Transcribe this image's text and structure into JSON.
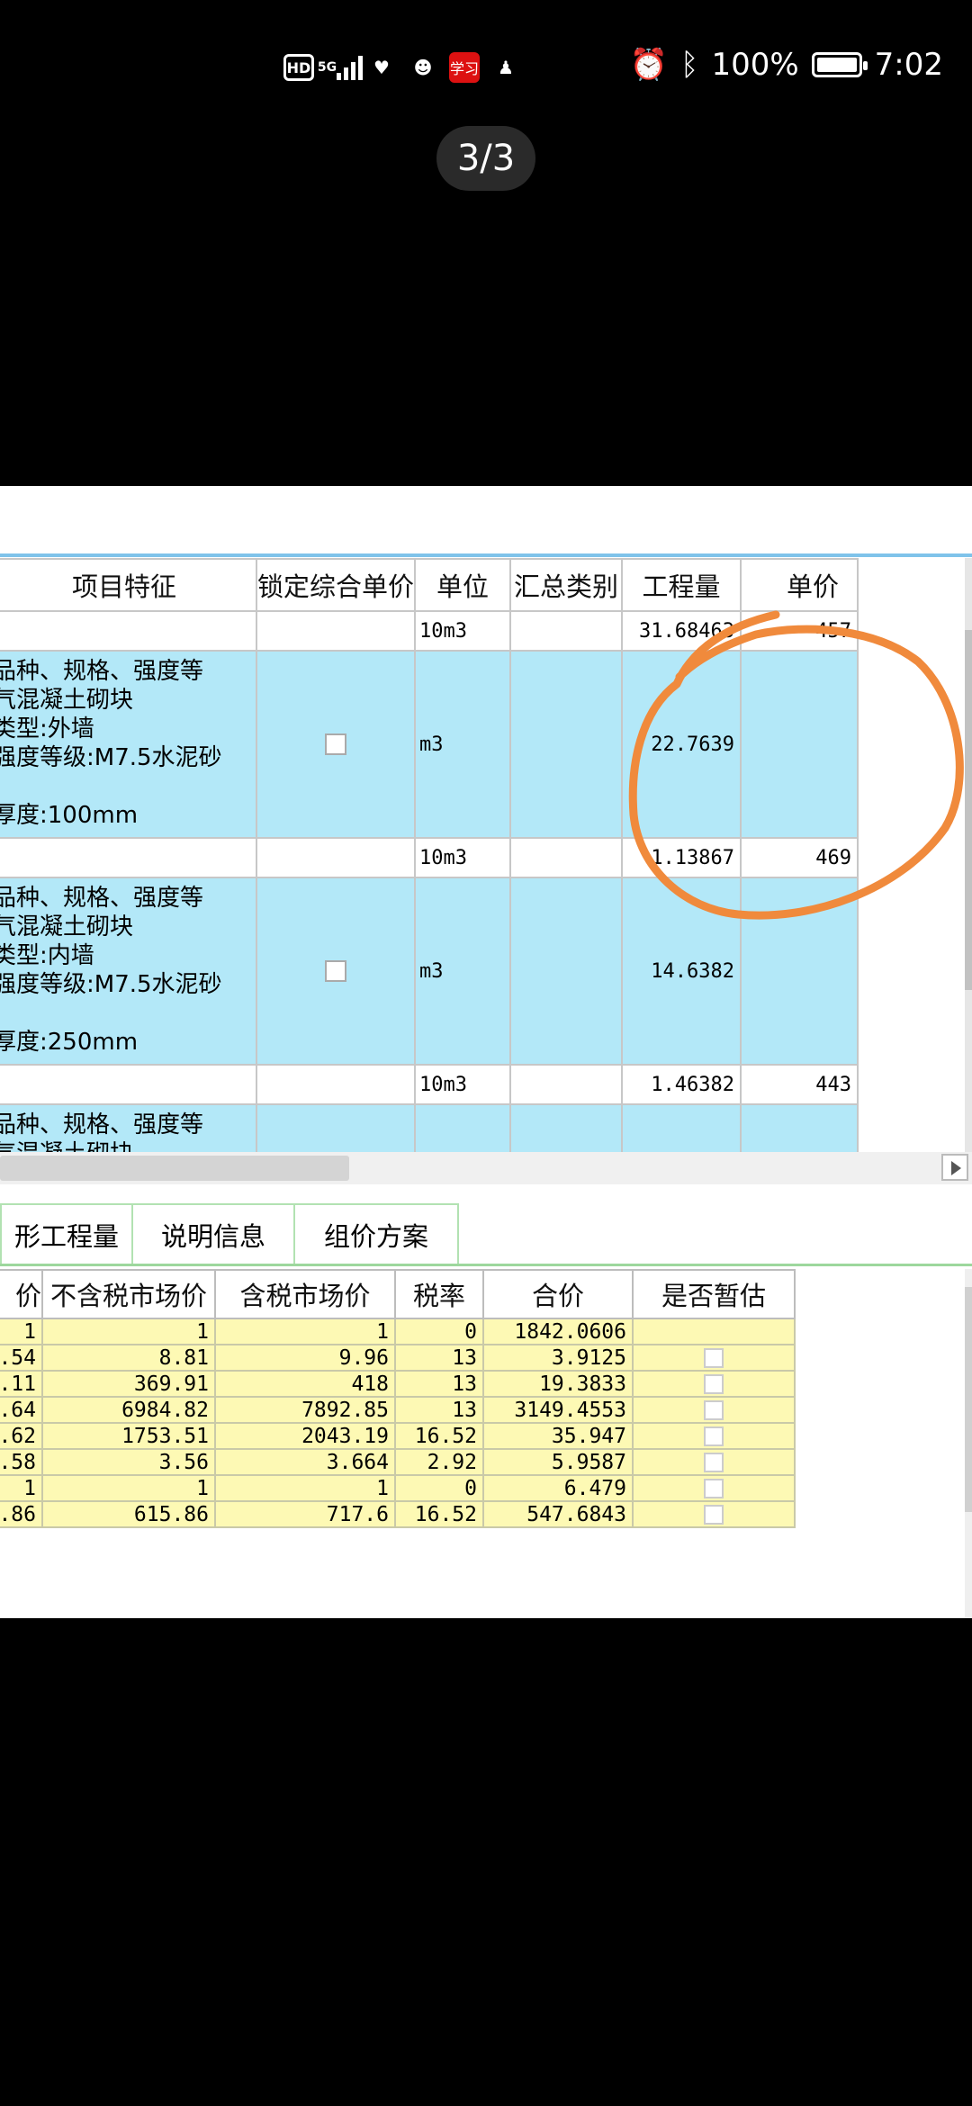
{
  "status_bar": {
    "hd": "HD",
    "network": "5G",
    "battery": "100%",
    "time": "7:02",
    "app_badge": "学习"
  },
  "pager": "3/3",
  "grid1": {
    "headers": [
      "项目特征",
      "锁定综合单价",
      "单位",
      "汇总类别",
      "工程量",
      "单价"
    ],
    "row1": {
      "unit": "10m3",
      "qty": "31.68463",
      "price": "457"
    },
    "item1": {
      "feature_lines": [
        "品种、规格、强度等",
        "气混凝土砌块",
        "类型:外墙",
        "强度等级:M7.5水泥砂",
        "",
        "厚度:100mm"
      ],
      "unit": "m3",
      "qty": "22.7639"
    },
    "row2": {
      "unit": "10m3",
      "qty": "1.13867",
      "price": "469"
    },
    "item2": {
      "feature_lines": [
        "品种、规格、强度等",
        "气混凝土砌块",
        "类型:内墙",
        "强度等级:M7.5水泥砂",
        "",
        "厚度:250mm"
      ],
      "unit": "m3",
      "qty": "14.6382"
    },
    "row3": {
      "unit": "10m3",
      "qty": "1.46382",
      "price": "443"
    },
    "item3": {
      "feature_lines": [
        "品种、规格、强度等",
        "气混凝土砌块"
      ]
    }
  },
  "tabs": [
    "形工程量",
    "说明信息",
    "组价方案"
  ],
  "grid2": {
    "headers": [
      "价",
      "不含税市场价",
      "含税市场价",
      "税率",
      "合价",
      "是否暂估"
    ],
    "rows": [
      [
        "1",
        "1",
        "1",
        "0",
        "1842.0606"
      ],
      [
        ".54",
        "8.81",
        "9.96",
        "13",
        "3.9125"
      ],
      [
        ".11",
        "369.91",
        "418",
        "13",
        "19.3833"
      ],
      [
        ".64",
        "6984.82",
        "7892.85",
        "13",
        "3149.4553"
      ],
      [
        ".62",
        "1753.51",
        "2043.19",
        "16.52",
        "35.947"
      ],
      [
        ".58",
        "3.56",
        "3.664",
        "2.92",
        "5.9587"
      ],
      [
        "1",
        "1",
        "1",
        "0",
        "6.479"
      ],
      [
        ".86",
        "615.86",
        "717.6",
        "16.52",
        "547.6843"
      ]
    ]
  },
  "colors": {
    "row_highlight": "#b3e8f8",
    "material_row": "#fdf9b4",
    "annotation": "#f08a3c"
  }
}
